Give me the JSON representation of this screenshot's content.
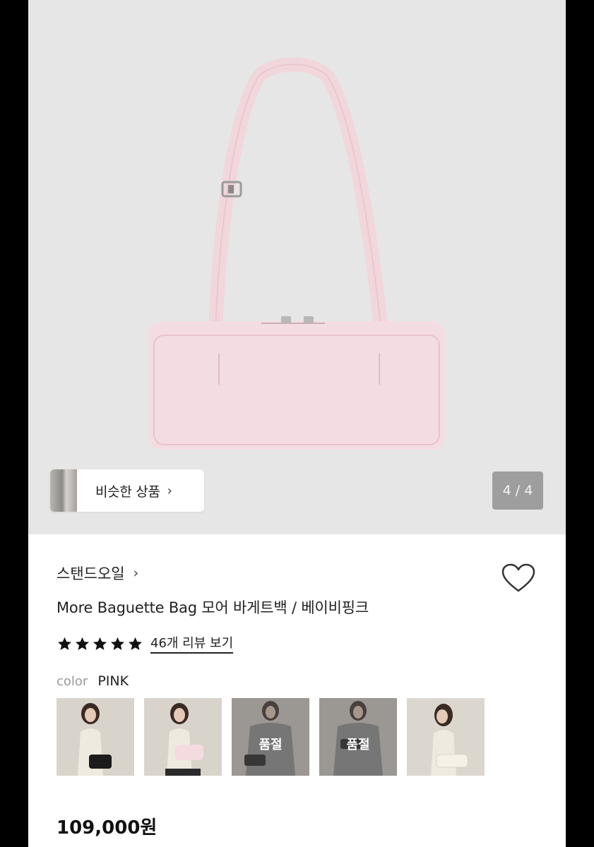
{
  "hero": {
    "similar_products_label": "비슷한 상품",
    "similar_chevron": "›",
    "page_counter": "4 / 4"
  },
  "product": {
    "brand": "스탠드오일",
    "brand_chevron": "›",
    "title": "More Baguette Bag 모어 바게트백 / 베이비핑크",
    "rating_stars": 5,
    "review_link": "46개 리뷰 보기",
    "color_label": "color",
    "color_value": "PINK",
    "swatches": [
      {
        "bag": "black",
        "status": ""
      },
      {
        "bag": "pink",
        "status": "",
        "selected": true
      },
      {
        "bag": "black",
        "status": "품절"
      },
      {
        "bag": "black",
        "status": "품절"
      },
      {
        "bag": "cream",
        "status": ""
      }
    ],
    "price": "109,000원"
  },
  "colors": {
    "hero_bg": "#e6e6e6",
    "bag_pink": "#f3dbe0",
    "counter_bg": "#9e9e9e"
  },
  "icons": {
    "wishlist": "heart-outline-icon",
    "rating": "star-icon"
  }
}
